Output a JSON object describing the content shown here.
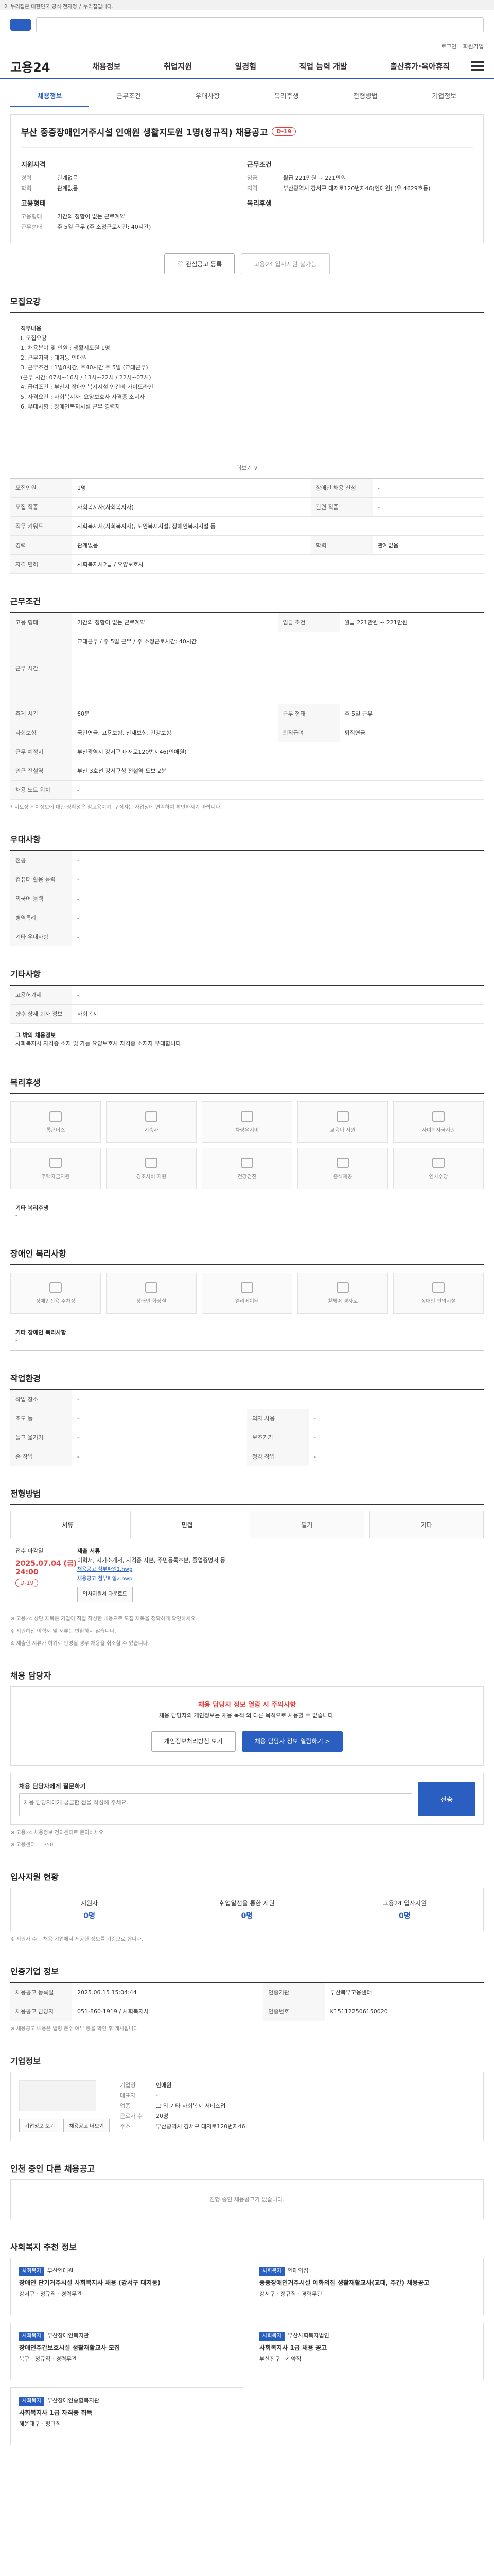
{
  "gov_banner": "이 누리집은 대한민국 공식 전자정부 누리집입니다.",
  "header": {
    "brand": "고용24",
    "menu": [
      "채용정보",
      "취업지원",
      "일경험",
      "직업 능력 개발",
      "출산휴가·육아휴직"
    ],
    "util_links": [
      "로그인",
      "회원가입"
    ]
  },
  "tabs": [
    "채용정보",
    "근무조건",
    "우대사항",
    "복리후생",
    "전형방법",
    "기업정보"
  ],
  "posting": {
    "title": "부산 중증장애인거주시설 인애원 생활지도원 1명(정규직) 채용공고",
    "dday": "D-19",
    "qualify_title": "지원자격",
    "career_label": "경력",
    "career_value": "관계없음",
    "edu_label": "학력",
    "edu_value": "관계없음",
    "cond_title": "근무조건",
    "wage_label": "임금",
    "wage_value": "월급 221만원 ~ 221만원",
    "area_label": "지역",
    "area_value": "부산광역시 강서구 대저로120번지46(인애원) (우 4629호동)",
    "emp_title": "고용형태",
    "emp_label1": "고용형태",
    "emp_value1": "기간의 정함이 없는 근로계약",
    "emp_label2": "근무형태",
    "emp_value2": "주 5일 근무 (주 소정근로시간: 40시간)",
    "welfare_title": "복리후생",
    "btn_save": "관심공고 등록",
    "btn_apply": "고용24 입사지원 불가능"
  },
  "recruit": {
    "section": "모집요강",
    "job_title": "직무내용",
    "content": "Ⅰ. 모집요강\n  1. 채용분야 및 인원 : 생활지도원 1명\n  2. 근무지역 : 대저동 인애원\n  3. 근무조건 : 1일8시간, 주40시간 주 5일 (교대근무)\n     (근무 시간: 07시~16시 / 13시~22시 / 22시~07시)\n  4. 급여조건 : 부산시 장애인복지시설 인건비 가이드라인\n  5. 자격요건 : 사회복지사, 요양보호사 자격증 소지자\n  6. 우대사항 : 장애인복지시설 근무 경력자",
    "more_btn": "더보기 ∨",
    "rows": [
      {
        "k": "모집인원",
        "v": "1명",
        "k2": "장애인 채용 신청",
        "v2": "-"
      },
      {
        "k": "모집 직종",
        "v": "사회복지사(사회복지사)",
        "k2": "관련 직종",
        "v2": "-"
      },
      {
        "k": "직무 키워드",
        "v": "사회복지사(사회복지사), 노인복지시설, 장애인복지시설 등",
        "k2": "",
        "v2": ""
      },
      {
        "k": "경력",
        "v": "관계없음",
        "k2": "학력",
        "v2": "관계없음"
      },
      {
        "k": "자격 면허",
        "v": "사회복지사2급 / 요양보호사",
        "k2": "",
        "v2": ""
      }
    ]
  },
  "work": {
    "section": "근무조건",
    "rows": [
      {
        "k": "고용 형태",
        "v": "기간의 정함이 없는 근로계약",
        "k2": "임금 조건",
        "v2": "월급 221만원 ~ 221만원"
      },
      {
        "k": "근무 시간",
        "v": "교대근무 / 주 5일 근무 / 주 소정근로시간: 40시간",
        "k2": "",
        "v2": ""
      },
      {
        "k": "휴게 시간",
        "v": "60분",
        "k2": "근무 형태",
        "v2": "주 5일 근무"
      },
      {
        "k": "사회보험",
        "v": "국민연금, 고용보험, 산재보험, 건강보험",
        "k2": "퇴직급여",
        "v2": "퇴직연금"
      },
      {
        "k": "근무 예정지",
        "v": "부산광역시 강서구 대저로120번지46(인애원)",
        "k2": "",
        "v2": ""
      },
      {
        "k": "인근 전철역",
        "v": "부산 3호선 강서구청 전철역 도보 2분",
        "k2": "",
        "v2": ""
      },
      {
        "k": "채용 노트 위치",
        "v": "-",
        "k2": "",
        "v2": ""
      }
    ],
    "note": "* 지도상 위치정보에 대한 정확성은 참고용이며, 구직자는 사업장에 연락하여 확인하시기 바랍니다."
  },
  "prefer": {
    "section": "우대사항",
    "rows": [
      {
        "k": "전공",
        "v": "-"
      },
      {
        "k": "컴퓨터 활용 능력",
        "v": "-"
      },
      {
        "k": "외국어 능력",
        "v": "-"
      },
      {
        "k": "병역특례",
        "v": "-"
      },
      {
        "k": "기타 우대사항",
        "v": "-"
      }
    ]
  },
  "worktype": {
    "section": "기타사항",
    "rows": [
      {
        "k": "고용허가제",
        "v": "-"
      },
      {
        "k": "향후 상세 회사 정보",
        "v": "사회복지"
      }
    ],
    "extra_title": "그 밖의 채용정보",
    "extra": "사회복지사 자격증 소지 및 가능 요양보호사 자격증 소지자 우대합니다."
  },
  "welfare": {
    "section": "복리후생",
    "items": [
      "통근버스",
      "기숙사",
      "차량유지비",
      "교육비 지원",
      "자녀학자금지원",
      "주택자금지원",
      "경조사비 지원",
      "건강검진",
      "중식제공",
      "연차수당"
    ],
    "note_title": "기타 복리후생",
    "note_value": "-"
  },
  "disabled": {
    "section": "장애인 복리사항",
    "items": [
      "장애인전용 주차장",
      "장애인 화장실",
      "엘리베이터",
      "휠체어 경사로",
      "장애인 편의시설"
    ],
    "note_title": "기타 장애인 복리사항",
    "note_value": "-"
  },
  "env": {
    "section": "작업환경",
    "rows": [
      {
        "k": "작업 장소",
        "v": "-",
        "k2": "",
        "v2": ""
      },
      {
        "k": "조도 등",
        "v": "-",
        "k2": "의자 사용",
        "v2": "-"
      },
      {
        "k": "들고 옮기기",
        "v": "-",
        "k2": "보조기기",
        "v2": "-"
      },
      {
        "k": "손 작업",
        "v": "-",
        "k2": "청각 작업",
        "v2": "-"
      }
    ]
  },
  "method": {
    "section": "전형방법",
    "items": [
      "서류",
      "면접",
      "필기",
      "기타"
    ],
    "doc_label": "접수 마감일",
    "deadline": "2025.07.04 (금) 24:00",
    "dday": "D-19",
    "submit_label": "제출 서류",
    "docs": "이력서, 자기소개서, 자격증 사본, 주민등록초본, 졸업증명서 등",
    "files": [
      "채용공고 첨부파일1.hwp",
      "채용공고 첨부파일2.hwp"
    ],
    "file_btn": "입사지원서 다운로드",
    "notes": [
      "※ 고용24 상단 제목은 기업이 직접 작성한 내용으로 모집 제목을 정확하게 확인하세요.",
      "※ 지원하신 이력서 및 서류는 반환하지 않습니다.",
      "※ 제출한 서류가 허위로 판명될 경우 채용을 취소할 수 있습니다."
    ]
  },
  "safety": {
    "section": "채용 담당자",
    "title": "채용 담당자 정보 열람 시 주의사항",
    "desc": "채용 담당자의 개인정보는 채용 목적 외 다른 목적으로 사용할 수 없습니다.",
    "btn1": "개인정보처리방침 보기",
    "btn2": "채용 담당자 정보 열람하기 >",
    "op_title": "채용 담당자에게 질문하기",
    "op_placeholder": "채용 담당자에게 궁금한 점을 작성해 주세요.",
    "op_submit": "전송",
    "notes": [
      "※ 고용24 채용정보 건의센터로 문의하세요.",
      "※ 고용센터 : 1350"
    ]
  },
  "apply_status": {
    "section": "입사지원 현황",
    "items": [
      {
        "label": "지원자",
        "value": "0명"
      },
      {
        "label": "취업알선을 통한 지원",
        "value": "0명"
      },
      {
        "label": "고용24 입사지원",
        "value": "0명"
      }
    ],
    "note": "※ 지원자 수는 채용 기업에서 제공한 정보를 기준으로 합니다."
  },
  "manage": {
    "section": "인증기업 정보",
    "rows": [
      {
        "k": "채용공고 등록일",
        "v": "2025.06.15 15:04:44",
        "k2": "인증기관",
        "v2": "부산북부고용센터"
      },
      {
        "k": "채용공고 담당자",
        "v": "051-860-1919 / 사회복지사",
        "k2": "인증번호",
        "v2": "K151122506150020"
      }
    ],
    "note": "※ 채용공고 내용은 법령 준수 여부 등을 확인 후 게시됩니다."
  },
  "company": {
    "section": "기업정보",
    "name_label": "기업명",
    "name": "인애원",
    "rep_label": "대표자",
    "rep": "-",
    "industry_label": "업종",
    "industry": "그 외 기타 사회복지 서비스업",
    "staff_label": "근로자 수",
    "staff": "20명",
    "addr_label": "주소",
    "addr": "부산광역시 강서구 대저로120번지46",
    "btn1": "기업정보 보기",
    "btn2": "채용공고 더보기"
  },
  "related": {
    "section": "인천 중인 다른 채용공고",
    "empty": "진행 중인 채용공고가 없습니다."
  },
  "recommend": {
    "section": "사회복지 추천 정보",
    "cards": [
      {
        "tag": "사회복지",
        "company": "부산인애원",
        "title": "장애인 단기거주시설 사회복지사 채용 (강서구 대저동)",
        "meta": "강서구 · 정규직 · 경력무관"
      },
      {
        "tag": "사회복지",
        "company": "인애의집",
        "title": "중증장애인거주시설 이화의집 생활재활교사(교대, 주간) 채용공고",
        "meta": "강서구 · 정규직 · 경력무관"
      },
      {
        "tag": "사회복지",
        "company": "부산장애인복지관",
        "title": "장애인주간보호시설 생활재활교사 모집",
        "meta": "북구 · 정규직 · 경력무관"
      },
      {
        "tag": "사회복지",
        "company": "부산사회복지법인",
        "title": "사회복지사 1급 채용 공고",
        "meta": "부산진구 · 계약직"
      },
      {
        "tag": "사회복지",
        "company": "부산장애인종합복지관",
        "title": "사회복지사 1급 자격증 취득",
        "meta": "해운대구 · 정규직"
      }
    ]
  }
}
